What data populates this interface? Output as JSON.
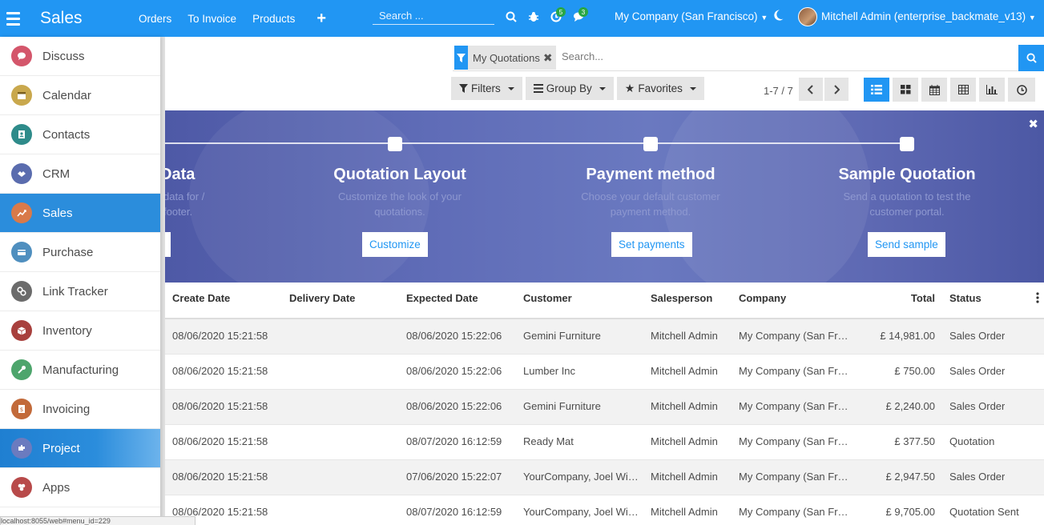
{
  "navbar": {
    "brand": "Sales",
    "menu": [
      "Orders",
      "To Invoice",
      "Products"
    ],
    "search_placeholder": "Search ...",
    "activity_count": "5",
    "message_count": "3",
    "company": "My Company (San Francisco)",
    "user": "Mitchell Admin (enterprise_backmate_v13)"
  },
  "control": {
    "facet_label": "My Quotations",
    "search_placeholder": "Search...",
    "filters_label": "Filters",
    "groupby_label": "Group By",
    "favorites_label": "Favorites",
    "pager": "1-7 / 7"
  },
  "banner": {
    "steps": [
      {
        "title": "Data",
        "desc": "data for / footer.",
        "button": ""
      },
      {
        "title": "Quotation Layout",
        "desc": "Customize the look of your quotations.",
        "button": "Customize"
      },
      {
        "title": "Payment method",
        "desc": "Choose your default customer payment method.",
        "button": "Set payments"
      },
      {
        "title": "Sample Quotation",
        "desc": "Send a quotation to test the customer portal.",
        "button": "Send sample"
      }
    ]
  },
  "table": {
    "headers": {
      "create": "Create Date",
      "delivery": "Delivery Date",
      "expected": "Expected Date",
      "customer": "Customer",
      "salesperson": "Salesperson",
      "company": "Company",
      "total": "Total",
      "status": "Status"
    },
    "rows": [
      {
        "create": "08/06/2020 15:21:58",
        "delivery": "",
        "expected": "08/06/2020 15:22:06",
        "customer": "Gemini Furniture",
        "salesperson": "Mitchell Admin",
        "company": "My Company (San Francisco)",
        "total": "£ 14,981.00",
        "status": "Sales Order"
      },
      {
        "create": "08/06/2020 15:21:58",
        "delivery": "",
        "expected": "08/06/2020 15:22:06",
        "customer": "Lumber Inc",
        "salesperson": "Mitchell Admin",
        "company": "My Company (San Francisco)",
        "total": "£ 750.00",
        "status": "Sales Order"
      },
      {
        "create": "08/06/2020 15:21:58",
        "delivery": "",
        "expected": "08/06/2020 15:22:06",
        "customer": "Gemini Furniture",
        "salesperson": "Mitchell Admin",
        "company": "My Company (San Francisco)",
        "total": "£ 2,240.00",
        "status": "Sales Order"
      },
      {
        "create": "08/06/2020 15:21:58",
        "delivery": "",
        "expected": "08/07/2020 16:12:59",
        "customer": "Ready Mat",
        "salesperson": "Mitchell Admin",
        "company": "My Company (San Francisco)",
        "total": "£ 377.50",
        "status": "Quotation"
      },
      {
        "create": "08/06/2020 15:21:58",
        "delivery": "",
        "expected": "07/06/2020 15:22:07",
        "customer": "YourCompany, Joel Willis",
        "salesperson": "Mitchell Admin",
        "company": "My Company (San Francisco)",
        "total": "£ 2,947.50",
        "status": "Sales Order"
      },
      {
        "create": "08/06/2020 15:21:58",
        "delivery": "",
        "expected": "08/07/2020 16:12:59",
        "customer": "YourCompany, Joel Willis",
        "salesperson": "Mitchell Admin",
        "company": "My Company (San Francisco)",
        "total": "£ 9,705.00",
        "status": "Quotation Sent"
      }
    ]
  },
  "drawer": {
    "apps": [
      {
        "label": "Discuss",
        "icon": "discuss-icon",
        "color": "#d4566b"
      },
      {
        "label": "Calendar",
        "icon": "calendar-icon",
        "color": "#c9a84d"
      },
      {
        "label": "Contacts",
        "icon": "contacts-icon",
        "color": "#2e8b8a"
      },
      {
        "label": "CRM",
        "icon": "crm-icon",
        "color": "#5a6cae"
      },
      {
        "label": "Sales",
        "icon": "sales-icon",
        "color": "#d97a4a"
      },
      {
        "label": "Purchase",
        "icon": "purchase-icon",
        "color": "#4f8fbf"
      },
      {
        "label": "Link Tracker",
        "icon": "link-tracker-icon",
        "color": "#6b6b6b"
      },
      {
        "label": "Inventory",
        "icon": "inventory-icon",
        "color": "#a8403d"
      },
      {
        "label": "Manufacturing",
        "icon": "manufacturing-icon",
        "color": "#4da56c"
      },
      {
        "label": "Invoicing",
        "icon": "invoicing-icon",
        "color": "#c26a3a"
      },
      {
        "label": "Project",
        "icon": "project-icon",
        "color": "#6b7bbf"
      },
      {
        "label": "Apps",
        "icon": "apps-icon",
        "color": "#b84a4a"
      }
    ]
  },
  "status_url": "localhost:8055/web#menu_id=229"
}
